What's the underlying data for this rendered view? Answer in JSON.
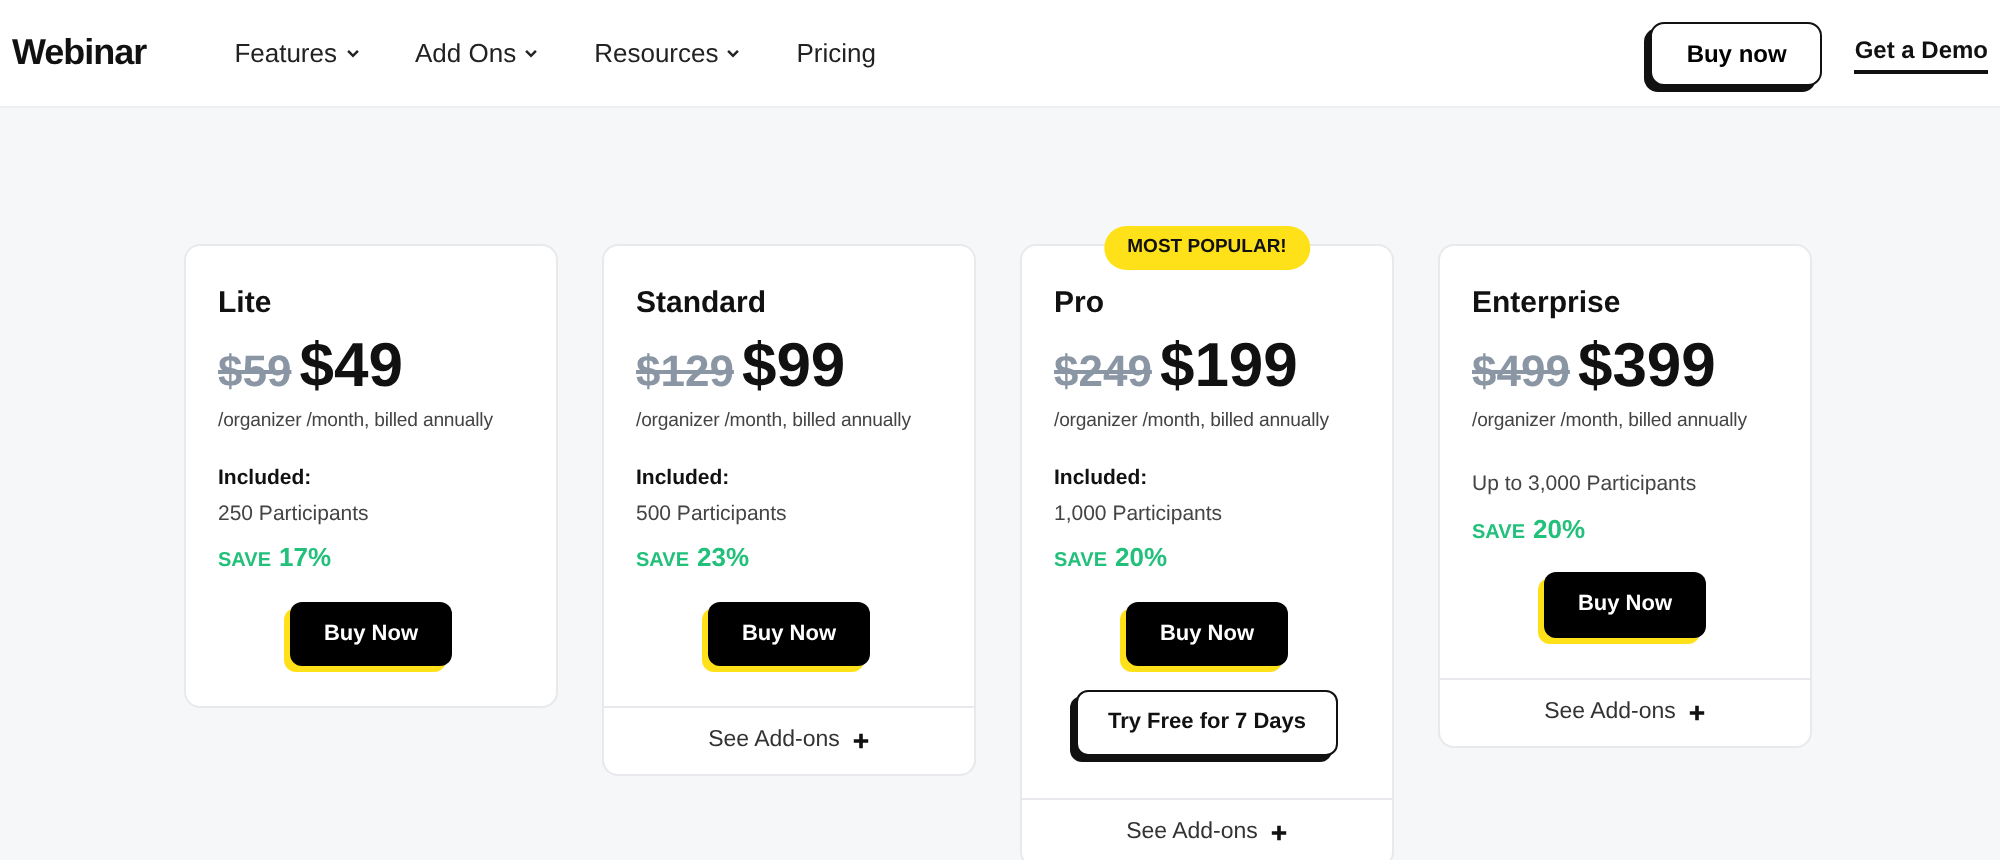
{
  "navbar": {
    "logo": "Webinar",
    "links": [
      {
        "label": "Features",
        "has_dropdown": true
      },
      {
        "label": "Add Ons",
        "has_dropdown": true
      },
      {
        "label": "Resources",
        "has_dropdown": true
      },
      {
        "label": "Pricing",
        "has_dropdown": false
      }
    ],
    "buy_button": "Buy now",
    "demo_link": "Get a Demo"
  },
  "plans": [
    {
      "name": "Lite",
      "old_price": "$59",
      "price": "$49",
      "billing": "/organizer /month, billed annually",
      "included_label": "Included:",
      "participants": "250 Participants",
      "save_label": "SAVE",
      "save_value": "17%",
      "buy_label": "Buy Now"
    },
    {
      "name": "Standard",
      "old_price": "$129",
      "price": "$99",
      "billing": "/organizer /month, billed annually",
      "included_label": "Included:",
      "participants": "500 Participants",
      "save_label": "SAVE",
      "save_value": "23%",
      "buy_label": "Buy Now",
      "addons_label": "See Add-ons"
    },
    {
      "name": "Pro",
      "badge": "MOST POPULAR!",
      "old_price": "$249",
      "price": "$199",
      "billing": "/organizer /month, billed annually",
      "included_label": "Included:",
      "participants": "1,000 Participants",
      "save_label": "SAVE",
      "save_value": "20%",
      "buy_label": "Buy Now",
      "trial_label": "Try Free for 7 Days",
      "addons_label": "See Add-ons"
    },
    {
      "name": "Enterprise",
      "old_price": "$499",
      "price": "$399",
      "billing": "/organizer /month, billed annually",
      "participants": "Up to 3,000 Participants",
      "save_label": "SAVE",
      "save_value": "20%",
      "buy_label": "Buy Now",
      "addons_label": "See Add-ons"
    }
  ]
}
